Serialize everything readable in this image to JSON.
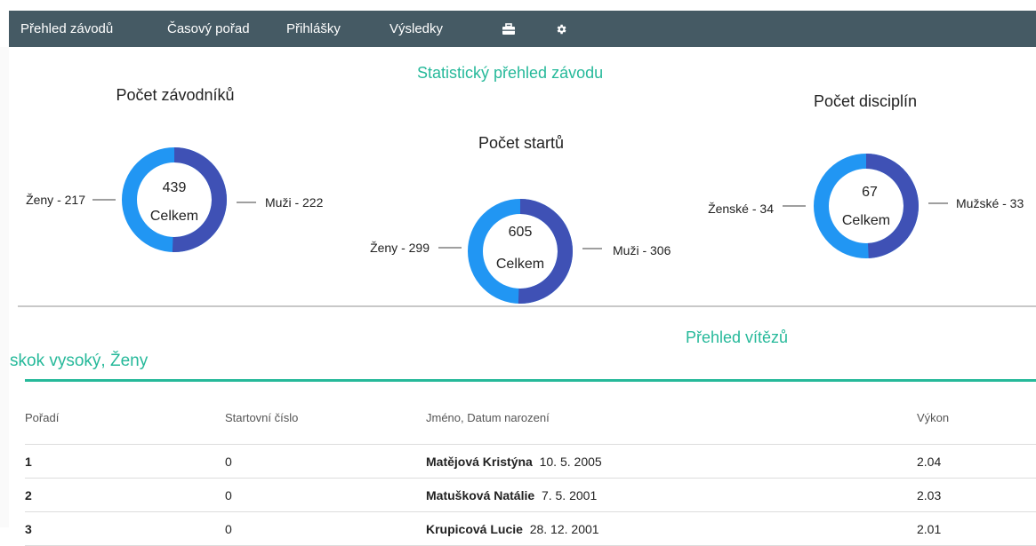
{
  "navbar": {
    "items": [
      "Přehled závodů",
      "Časový pořad",
      "Přihlášky",
      "Výsledky"
    ],
    "icons": [
      "toolbox-icon",
      "gear-icon"
    ]
  },
  "stats": {
    "title": "Statistický přehled závodu",
    "center_label": "Celkem",
    "competitors": {
      "title": "Počet závodníků",
      "total": "439",
      "left": "Ženy - 217",
      "right": "Muži - 222",
      "left_value": 217,
      "right_value": 222
    },
    "starts": {
      "title": "Počet startů",
      "total": "605",
      "left": "Ženy - 299",
      "right": "Muži - 306",
      "left_value": 299,
      "right_value": 306
    },
    "disciplines": {
      "title": "Počet disciplín",
      "total": "67",
      "left": "Ženské - 34",
      "right": "Mužské - 33",
      "left_value": 34,
      "right_value": 33
    }
  },
  "colors": {
    "accent": "#26b99a",
    "navbar": "#455a64",
    "donut_women": "#2196f3",
    "donut_men": "#3f51b5"
  },
  "winners": {
    "title": "Přehled vítězů",
    "discipline": "skok vysoký, Ženy",
    "columns": [
      "Pořadí",
      "Startovní číslo",
      "Jméno, Datum narození",
      "Výkon"
    ],
    "rows": [
      {
        "rank": "1",
        "start_no": "0",
        "name": "Matějová Kristýna",
        "dob": "10. 5. 2005",
        "result": "2.04"
      },
      {
        "rank": "2",
        "start_no": "0",
        "name": "Matušková Natálie",
        "dob": "7. 5. 2001",
        "result": "2.03"
      },
      {
        "rank": "3",
        "start_no": "0",
        "name": "Krupicová Lucie",
        "dob": "28. 12. 2001",
        "result": "2.01"
      }
    ]
  }
}
